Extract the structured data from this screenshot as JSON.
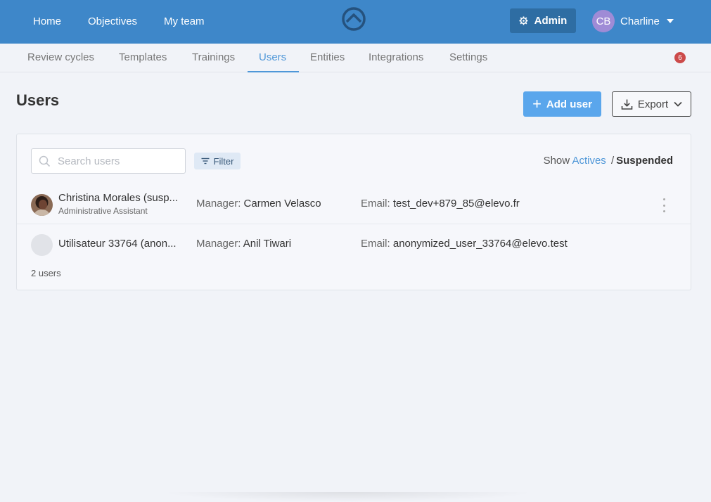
{
  "topbar": {
    "nav": [
      "Home",
      "Objectives",
      "My team"
    ],
    "admin_label": "Admin",
    "user_initials": "CB",
    "user_name": "Charline",
    "colors": {
      "bar": "#3e87c9",
      "admin": "#2e6da3",
      "avatar": "#9f8bd6"
    }
  },
  "subnav": {
    "tabs": [
      "Review cycles",
      "Templates",
      "Trainings",
      "Users",
      "Entities",
      "Integrations",
      "Settings"
    ],
    "active_tab": "Users",
    "badge": "6"
  },
  "page": {
    "title": "Users",
    "add_user_label": "Add user",
    "export_label": "Export"
  },
  "list": {
    "search_placeholder": "Search users",
    "filter_label": "Filter",
    "show_label": "Show",
    "show_actives": "Actives",
    "show_separator": "/",
    "show_suspended": "Suspended",
    "manager_label": "Manager:",
    "email_label": "Email:",
    "users": [
      {
        "name": "Christina Morales (susp...",
        "job": "Administrative Assistant",
        "manager": "Carmen Velasco",
        "email": "test_dev+879_85@elevo.fr"
      },
      {
        "name": "Utilisateur 33764 (anon...",
        "job": "",
        "manager": "Anil Tiwari",
        "email": "anonymized_user_33764@elevo.test"
      }
    ],
    "count_text": "2 users"
  }
}
